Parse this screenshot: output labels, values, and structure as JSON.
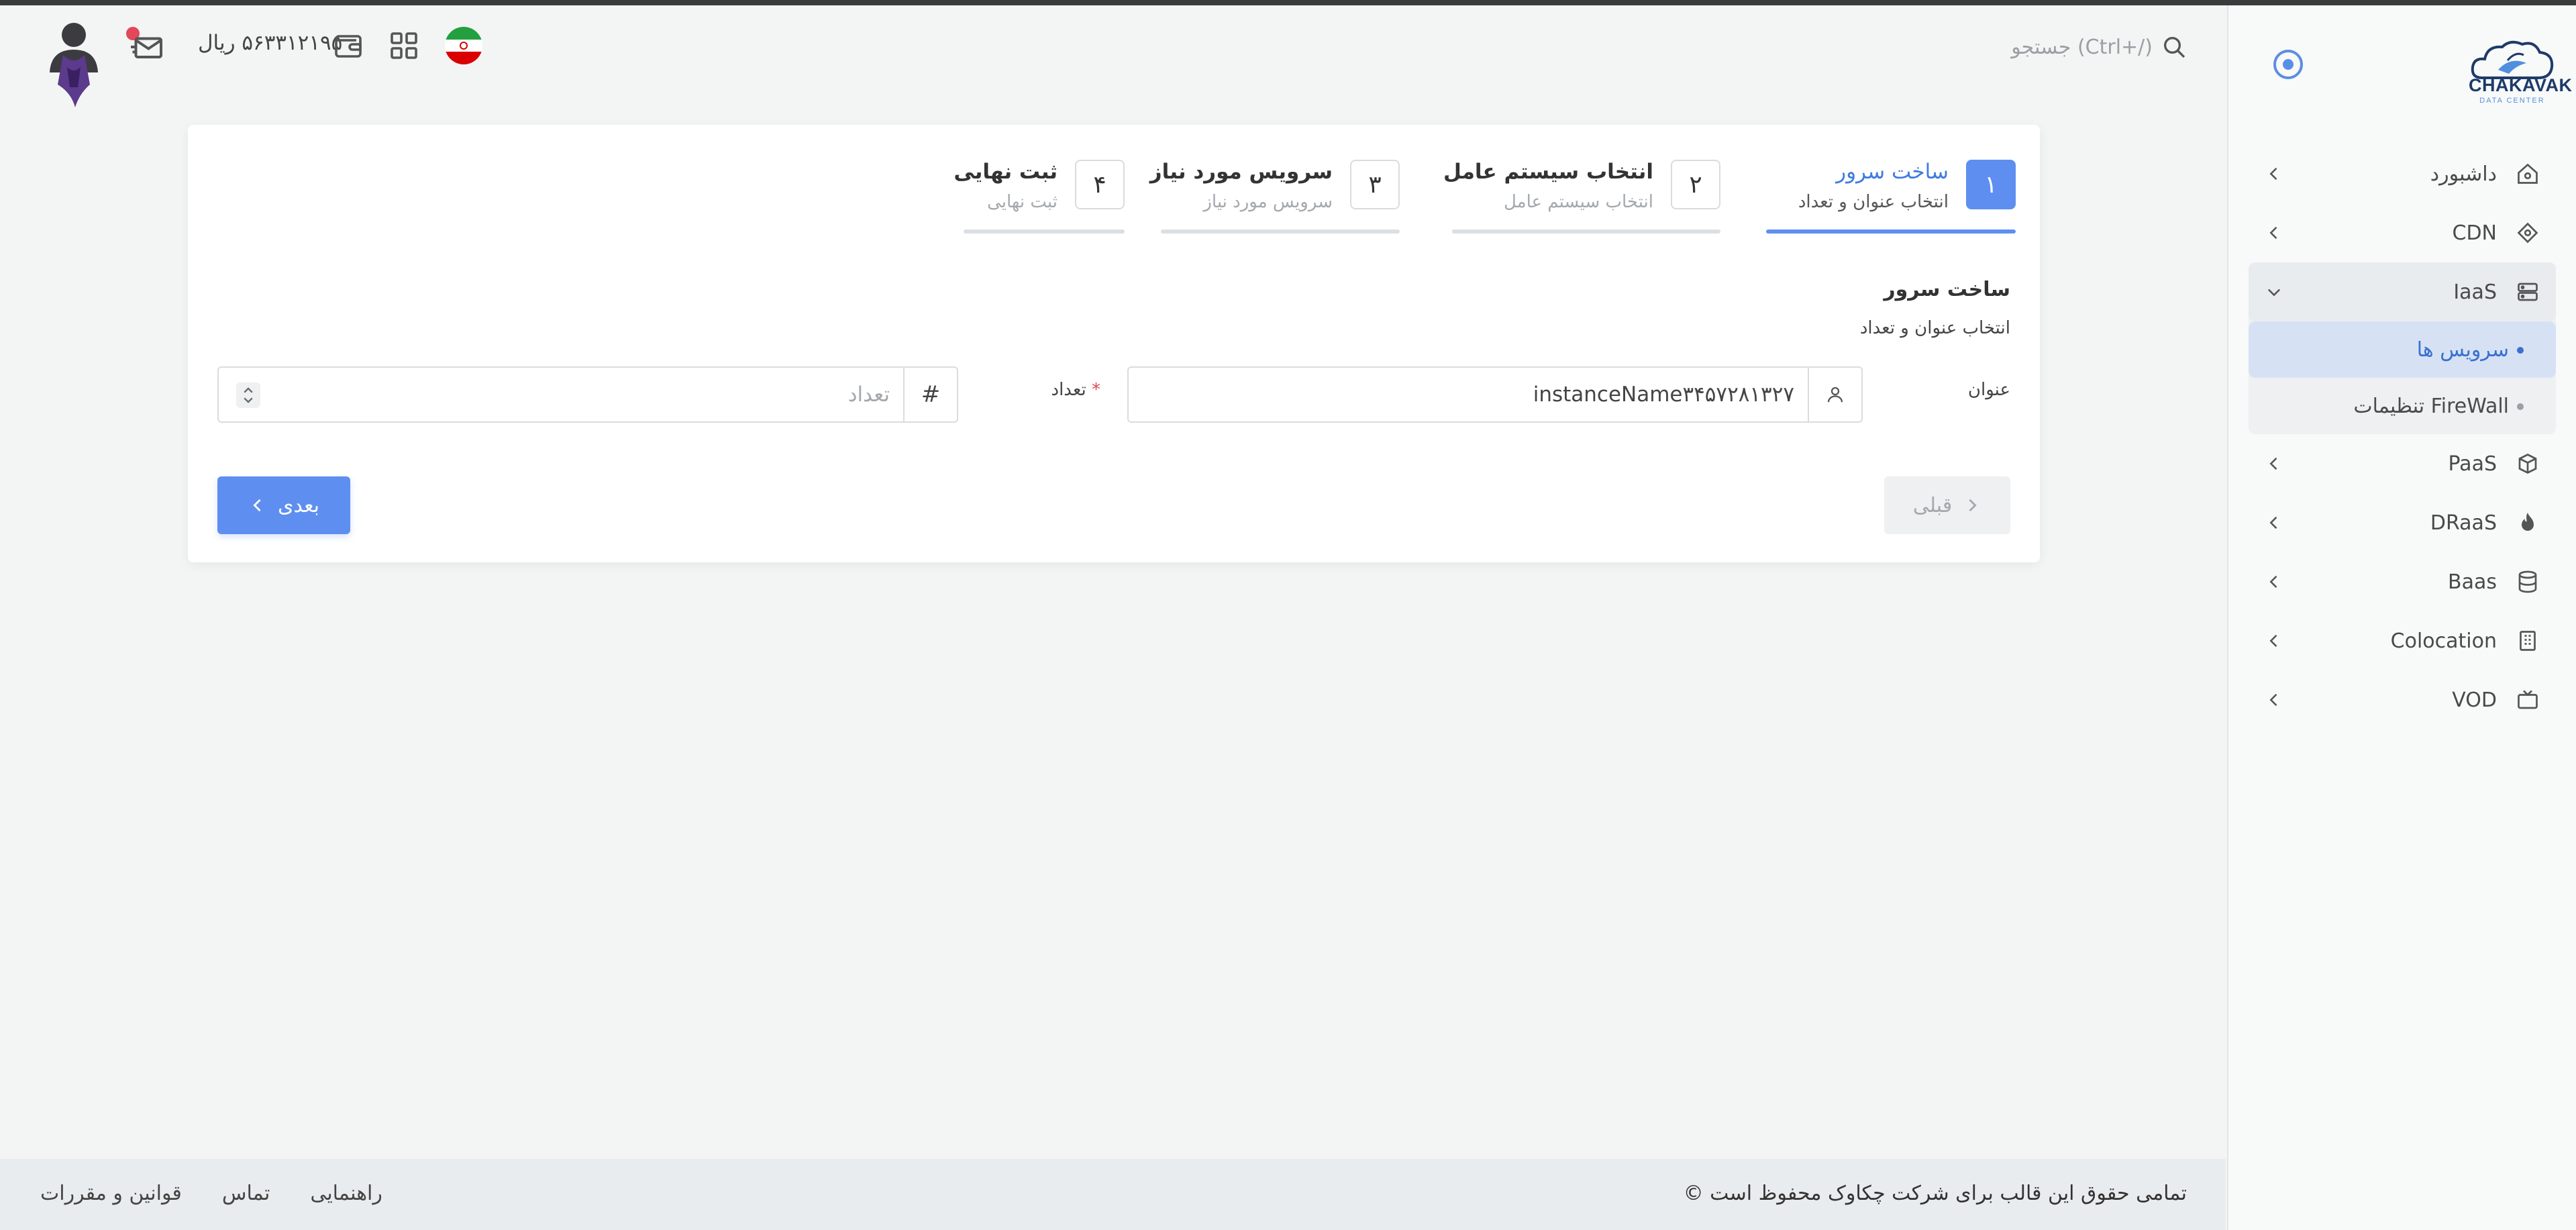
{
  "brand": {
    "name": "CHAKAVAK",
    "tagline": "DATA CENTER",
    "accent": "#5e8ff0"
  },
  "header": {
    "search_placeholder": "جستجو (Ctrl+/)",
    "balance": "۵۶۳۳۱۲۱۹۵ ریال",
    "icons": [
      "search-icon",
      "mail-icon",
      "wallet-icon",
      "apps-grid-icon",
      "iran-flag-icon",
      "avatar"
    ]
  },
  "sidebar": {
    "items": [
      {
        "label": "داشبورد",
        "icon": "home-icon"
      },
      {
        "label": "CDN",
        "icon": "cdn-icon"
      },
      {
        "label": "IaaS",
        "icon": "server-icon",
        "open": true,
        "children": [
          {
            "label": "سرویس ها",
            "active": true
          },
          {
            "label": "تنظیمات FireWall"
          }
        ]
      },
      {
        "label": "PaaS",
        "icon": "box-icon"
      },
      {
        "label": "DRaaS",
        "icon": "flame-icon"
      },
      {
        "label": "Baas",
        "icon": "database-icon"
      },
      {
        "label": "Colocation",
        "icon": "building-icon"
      },
      {
        "label": "VOD",
        "icon": "tv-icon"
      }
    ]
  },
  "wizard": {
    "steps": [
      {
        "num": "۱",
        "title": "ساخت سرور",
        "sub": "انتخاب عنوان و تعداد",
        "active": true
      },
      {
        "num": "۲",
        "title": "انتخاب سیستم عامل",
        "sub": "انتخاب سیستم عامل"
      },
      {
        "num": "۳",
        "title": "سرویس مورد نیاز",
        "sub": "سرویس مورد نیاز"
      },
      {
        "num": "۴",
        "title": "ثبت نهایی",
        "sub": "ثبت نهایی"
      }
    ],
    "section_title": "ساخت سرور",
    "section_sub": "انتخاب عنوان و تعداد",
    "fields": {
      "title_label": "عنوان",
      "title_value": "instanceName۳۴۵۷۲۸۱۳۲۷",
      "count_label": "تعداد",
      "count_required": "*",
      "count_placeholder": "تعداد"
    },
    "buttons": {
      "prev": "قبلی",
      "next": "بعدی"
    }
  },
  "footer": {
    "copyright": "تمامی حقوق این قالب برای شرکت چکاوک محفوظ است ©",
    "links": [
      "راهنمایی",
      "تماس",
      "قوانین و مقررات"
    ]
  }
}
